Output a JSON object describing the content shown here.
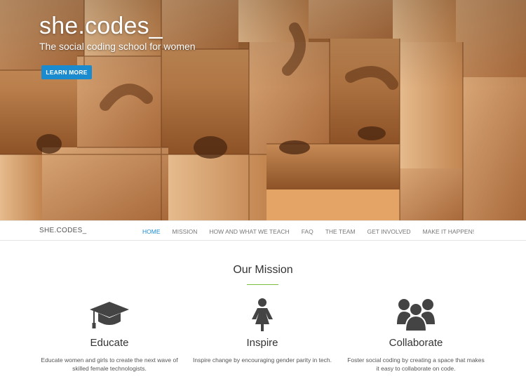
{
  "hero": {
    "title": "she.codes_",
    "subtitle": "The social coding school for women",
    "cta_label": "LEARN MORE"
  },
  "nav": {
    "brand": "SHE.CODES_",
    "items": [
      {
        "label": "HOME",
        "active": true
      },
      {
        "label": "MISSION"
      },
      {
        "label": "HOW AND WHAT WE TEACH"
      },
      {
        "label": "FAQ"
      },
      {
        "label": "THE TEAM"
      },
      {
        "label": "GET INVOLVED"
      },
      {
        "label": "MAKE IT HAPPEN!"
      }
    ]
  },
  "mission": {
    "title": "Our Mission",
    "features": [
      {
        "icon": "graduation-cap-icon",
        "title": "Educate",
        "text": "Educate women and girls to create the next wave of skilled female technologists."
      },
      {
        "icon": "woman-icon",
        "title": "Inspire",
        "text": "Inspire change by encouraging gender parity in tech."
      },
      {
        "icon": "group-icon",
        "title": "Collaborate",
        "text": "Foster social coding by creating a space that makes it easy to collaborate on code."
      }
    ]
  },
  "colors": {
    "accent": "#1b8bd0",
    "rule": "#7bbf3e"
  }
}
